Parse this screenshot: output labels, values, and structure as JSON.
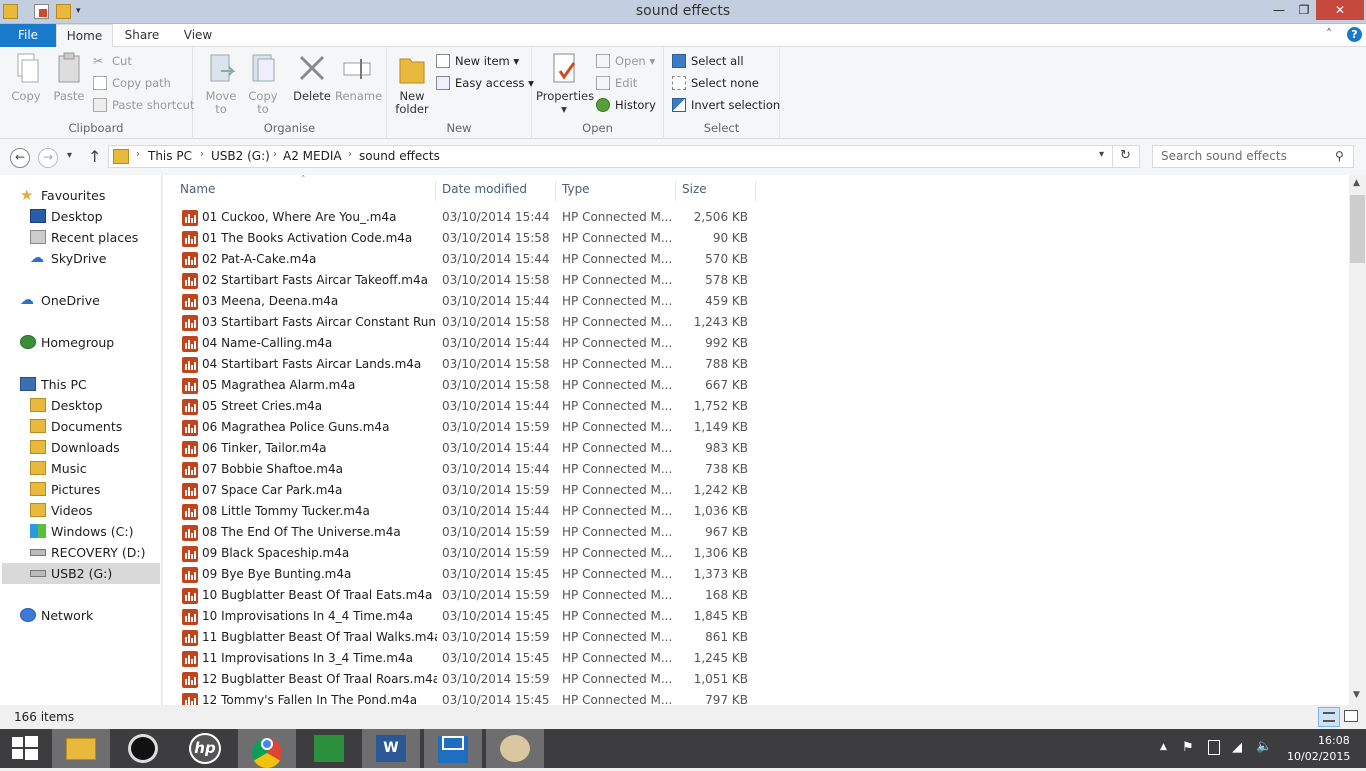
{
  "window": {
    "title": "sound effects"
  },
  "ribbon_tabs": [
    "File",
    "Home",
    "Share",
    "View"
  ],
  "ribbon": {
    "clipboard": {
      "label": "Clipboard",
      "copy": "Copy",
      "paste": "Paste",
      "cut": "Cut",
      "copy_path": "Copy path",
      "paste_shortcut": "Paste shortcut"
    },
    "organise": {
      "label": "Organise",
      "move_to_1": "Move",
      "move_to_2": "to",
      "copy_to_1": "Copy",
      "copy_to_2": "to",
      "delete": "Delete",
      "rename": "Rename"
    },
    "new": {
      "label": "New",
      "new_folder_1": "New",
      "new_folder_2": "folder",
      "new_item": "New item",
      "easy_access": "Easy access"
    },
    "open": {
      "label": "Open",
      "properties": "Properties",
      "open": "Open",
      "edit": "Edit",
      "history": "History"
    },
    "select": {
      "label": "Select",
      "select_all": "Select all",
      "select_none": "Select none",
      "invert_selection": "Invert selection"
    }
  },
  "address": {
    "crumbs": [
      "This PC",
      "USB2 (G:)",
      "A2 MEDIA",
      "sound effects"
    ]
  },
  "search": {
    "placeholder": "Search sound effects"
  },
  "nav": {
    "favourites": "Favourites",
    "desktop": "Desktop",
    "recent_places": "Recent places",
    "skydrive": "SkyDrive",
    "onedrive": "OneDrive",
    "homegroup": "Homegroup",
    "this_pc": "This PC",
    "pc_desktop": "Desktop",
    "documents": "Documents",
    "downloads": "Downloads",
    "music": "Music",
    "pictures": "Pictures",
    "videos": "Videos",
    "windows_c": "Windows (C:)",
    "recovery_d": "RECOVERY (D:)",
    "usb2_g": "USB2 (G:)",
    "network": "Network"
  },
  "columns": {
    "name": "Name",
    "date": "Date modified",
    "type": "Type",
    "size": "Size"
  },
  "files": [
    {
      "name": "01 Cuckoo, Where Are You_.m4a",
      "date": "03/10/2014 15:44",
      "type": "HP Connected M...",
      "size": "2,506 KB"
    },
    {
      "name": "01 The Books Activation Code.m4a",
      "date": "03/10/2014 15:58",
      "type": "HP Connected M...",
      "size": "90 KB"
    },
    {
      "name": "02 Pat-A-Cake.m4a",
      "date": "03/10/2014 15:44",
      "type": "HP Connected M...",
      "size": "570 KB"
    },
    {
      "name": "02 Startibart Fasts Aircar Takeoff.m4a",
      "date": "03/10/2014 15:58",
      "type": "HP Connected M...",
      "size": "578 KB"
    },
    {
      "name": "03 Meena, Deena.m4a",
      "date": "03/10/2014 15:44",
      "type": "HP Connected M...",
      "size": "459 KB"
    },
    {
      "name": "03 Startibart Fasts Aircar Constant Run.m...",
      "date": "03/10/2014 15:58",
      "type": "HP Connected M...",
      "size": "1,243 KB"
    },
    {
      "name": "04 Name-Calling.m4a",
      "date": "03/10/2014 15:44",
      "type": "HP Connected M...",
      "size": "992 KB"
    },
    {
      "name": "04 Startibart Fasts Aircar Lands.m4a",
      "date": "03/10/2014 15:58",
      "type": "HP Connected M...",
      "size": "788 KB"
    },
    {
      "name": "05 Magrathea Alarm.m4a",
      "date": "03/10/2014 15:58",
      "type": "HP Connected M...",
      "size": "667 KB"
    },
    {
      "name": "05 Street Cries.m4a",
      "date": "03/10/2014 15:44",
      "type": "HP Connected M...",
      "size": "1,752 KB"
    },
    {
      "name": "06 Magrathea Police Guns.m4a",
      "date": "03/10/2014 15:59",
      "type": "HP Connected M...",
      "size": "1,149 KB"
    },
    {
      "name": "06 Tinker, Tailor.m4a",
      "date": "03/10/2014 15:44",
      "type": "HP Connected M...",
      "size": "983 KB"
    },
    {
      "name": "07 Bobbie Shaftoe.m4a",
      "date": "03/10/2014 15:44",
      "type": "HP Connected M...",
      "size": "738 KB"
    },
    {
      "name": "07 Space Car Park.m4a",
      "date": "03/10/2014 15:59",
      "type": "HP Connected M...",
      "size": "1,242 KB"
    },
    {
      "name": "08 Little Tommy Tucker.m4a",
      "date": "03/10/2014 15:44",
      "type": "HP Connected M...",
      "size": "1,036 KB"
    },
    {
      "name": "08 The End Of The Universe.m4a",
      "date": "03/10/2014 15:59",
      "type": "HP Connected M...",
      "size": "967 KB"
    },
    {
      "name": "09 Black Spaceship.m4a",
      "date": "03/10/2014 15:59",
      "type": "HP Connected M...",
      "size": "1,306 KB"
    },
    {
      "name": "09 Bye Bye Bunting.m4a",
      "date": "03/10/2014 15:45",
      "type": "HP Connected M...",
      "size": "1,373 KB"
    },
    {
      "name": "10 Bugblatter Beast Of Traal Eats.m4a",
      "date": "03/10/2014 15:59",
      "type": "HP Connected M...",
      "size": "168 KB"
    },
    {
      "name": "10 Improvisations In 4_4 Time.m4a",
      "date": "03/10/2014 15:45",
      "type": "HP Connected M...",
      "size": "1,845 KB"
    },
    {
      "name": "11 Bugblatter Beast Of Traal Walks.m4a",
      "date": "03/10/2014 15:59",
      "type": "HP Connected M...",
      "size": "861 KB"
    },
    {
      "name": "11 Improvisations In 3_4 Time.m4a",
      "date": "03/10/2014 15:45",
      "type": "HP Connected M...",
      "size": "1,245 KB"
    },
    {
      "name": "12 Bugblatter Beast Of Traal Roars.m4a",
      "date": "03/10/2014 15:59",
      "type": "HP Connected M...",
      "size": "1,051 KB"
    },
    {
      "name": "12 Tommy's Fallen In The Pond.m4a",
      "date": "03/10/2014 15:45",
      "type": "HP Connected M...",
      "size": "797 KB"
    }
  ],
  "status": {
    "item_count": "166 items"
  },
  "taskbar": {
    "time": "16:08",
    "date": "10/02/2015"
  },
  "colors": {
    "file_tab": "#1979ca",
    "close_button": "#c7483c",
    "taskbar": "#3d3d3f",
    "file_icon": "#c1441d"
  }
}
